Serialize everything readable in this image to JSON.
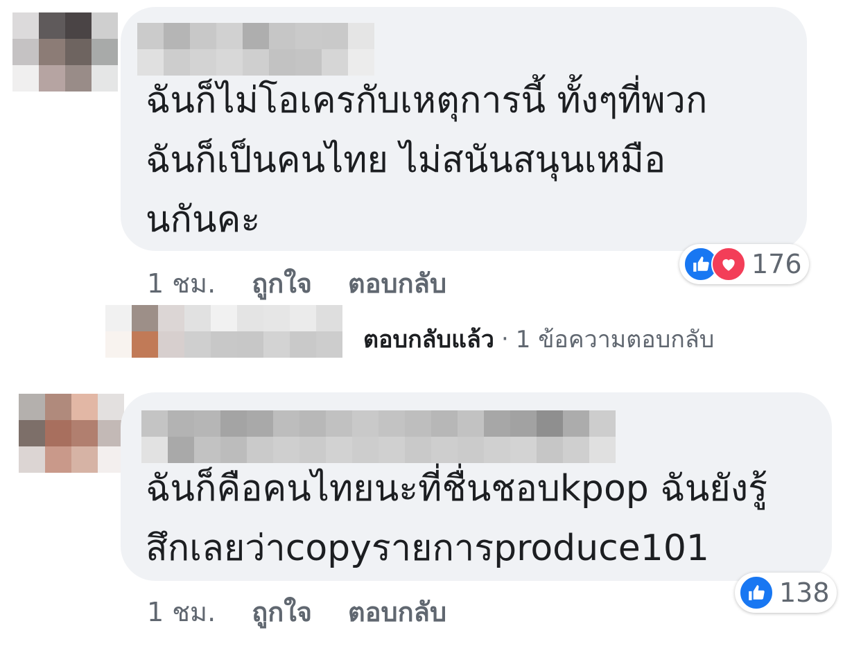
{
  "comments": [
    {
      "text_lines": [
        "ฉันก็ไม่โอเครกับเหตุการนี้ ทั้งๆที่พวก",
        "ฉันก็เป็นคนไทย ไม่สนันสนุนเหมือ",
        "นกันคะ"
      ],
      "time": "1 ชม.",
      "like_label": "ถูกใจ",
      "reply_label": "ตอบกลับ",
      "reactions": [
        "like-icon",
        "love-icon"
      ],
      "reaction_count": "176"
    },
    {
      "text_lines": [
        "ฉันก็คือคนไทยนะที่ชื่นชอบkpop ฉันยังรู้",
        "สึกเลยว่าcopyรายการproduce101"
      ],
      "time": "1 ชม.",
      "like_label": "ถูกใจ",
      "reply_label": "ตอบกลับ",
      "reactions": [
        "like-icon"
      ],
      "reaction_count": "138"
    }
  ],
  "reply_summary": {
    "replied_label": "ตอบกลับแล้ว",
    "separator": "·",
    "count_label": "1 ข้อความตอบกลับ"
  },
  "colors": {
    "bubble": "#f0f2f5",
    "text": "#1c1e21",
    "meta": "#606770",
    "like": "#1877f2",
    "love": "#f33e58"
  }
}
